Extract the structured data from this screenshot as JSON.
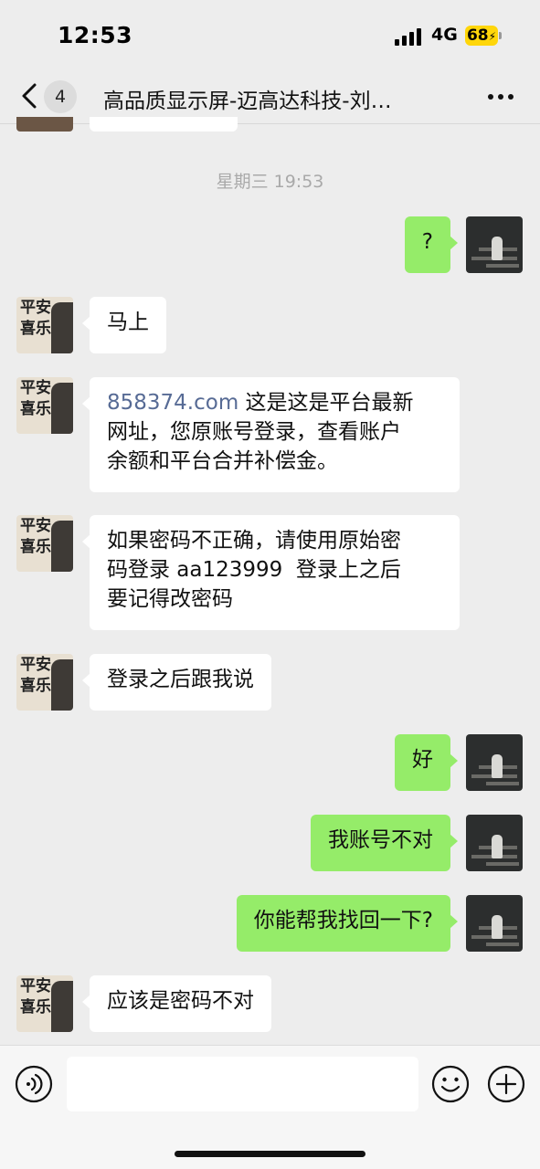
{
  "status_bar": {
    "time": "12:53",
    "network": "4G",
    "battery": "68"
  },
  "nav": {
    "unread_count": "4",
    "title": "高品质显示屏-迈高达科技-刘…"
  },
  "timestamp": "星期三 19:53",
  "messages": [
    {
      "side": "right",
      "text": "?"
    },
    {
      "side": "left",
      "text": "马上"
    },
    {
      "side": "left",
      "link": "858374.com",
      "line1_rest": " 这是这是平台最新",
      "line2": "网址，您原账号登录，查看账户",
      "line3": "余额和平台合并补偿金。"
    },
    {
      "side": "left",
      "line1": "如果密码不正确，请使用原始密",
      "line2": "码登录 aa123999  登录上之后",
      "line3": "要记得改密码"
    },
    {
      "side": "left",
      "text": "登录之后跟我说"
    },
    {
      "side": "right",
      "text": "好"
    },
    {
      "side": "right",
      "text": "我账号不对"
    },
    {
      "side": "right",
      "text": "你能帮我找回一下?"
    },
    {
      "side": "left",
      "text": "应该是密码不对"
    }
  ],
  "input": {
    "value": ""
  },
  "colors": {
    "background": "#ededed",
    "sent_bubble": "#95ec69",
    "received_bubble": "#ffffff",
    "link": "#576b95",
    "battery": "#ffd60a"
  },
  "icons": {
    "back": "chevron-left-icon",
    "more": "ellipsis-icon",
    "voice": "voice-icon",
    "emoji": "smiley-icon",
    "plus": "plus-icon"
  }
}
